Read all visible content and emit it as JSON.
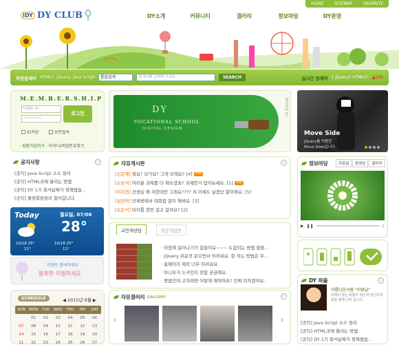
{
  "util": [
    "HOME",
    "SITEMAP",
    "FAVORITE"
  ],
  "logo": {
    "badge": "IDY",
    "name": "DY CLUB"
  },
  "gnb": [
    "DY소개",
    "커뮤니티",
    "갤러리",
    "정보마당",
    "DY운영"
  ],
  "search": {
    "label": "추천검색어",
    "hint": "HTML5, jQuery, Java Script",
    "select": "통합검색",
    "placeholder": "검색어를 입력해 주세요",
    "button": "SEARCH",
    "realtime_label": "실시간 검색어",
    "realtime_word": "1 jQuery? HTML5?",
    "realtime_count": "▲230"
  },
  "member": {
    "title": "M.E.M.B.E.R.S.H.I.P",
    "user_ph": "USER ID",
    "pass_ph": "••••••••",
    "login": "로그인",
    "save_id": "ID저장",
    "secure": "보안접속",
    "join": "· 회원가입하기",
    "find": "· 아이디/비밀번호찾기"
  },
  "notice_left": {
    "title": "공지사항",
    "items": [
      "[공지] Java Script 소스 정리",
      "[공지] HTML과제 올리는 방법",
      "[공지] DY 1기 회식날짜가 정해졌습...",
      "[공지] 물랑회원정리 들어갑니다."
    ]
  },
  "weather": {
    "word": "Today",
    "date": "월요일, 07/06",
    "temp": "28°",
    "f1_date": "10/18 25°",
    "f1_low": "11°",
    "f2_date": "10/18 25°",
    "f2_low": "11°"
  },
  "event": {
    "line1": "이벤트 참여하세요",
    "line2": "불혹한 리필하세요"
  },
  "schedule": {
    "title": "SCHEDULE",
    "month": "2015년 6월",
    "days": [
      "SUN",
      "MON",
      "TUE",
      "WED",
      "THU",
      "FRI",
      "SAT"
    ],
    "rows": [
      [
        "",
        "01",
        "02",
        "03",
        "04",
        "05",
        "06"
      ],
      [
        "07",
        "08",
        "09",
        "10",
        "11",
        "12",
        "13"
      ],
      [
        "14",
        "15",
        "16",
        "17",
        "18",
        "19",
        "20"
      ],
      [
        "21",
        "22",
        "23",
        "24",
        "25",
        "26",
        "27"
      ]
    ]
  },
  "banner": {
    "big": "DY",
    "line1": "VOCATIONAL SCHOOL",
    "line2": "DIGITAL DESIGN",
    "side": "NOTICE 01"
  },
  "board": {
    "title": "자유게시판",
    "items": [
      {
        "cat": "[신문혜]",
        "text": "뭐요? 모가요? 그게 모에요? [4]",
        "new": true
      },
      {
        "cat": "[오은석]",
        "text": "여러분 과제를 다 해오셨죠? 과제한거 업어보세요. [1]",
        "new": true
      },
      {
        "cat": "[이지연]",
        "text": "선생님 왜 저한테만 그래요???? 저 어제도 날겠단 말이에요. [5]",
        "new": false
      },
      {
        "cat": "[심진아]",
        "text": "단록방에서 대화좀 많이 해봐요. [3]",
        "new": false
      },
      {
        "cat": "[오은석]",
        "text": "타이틀 한번 걸고 갈까요? [2]",
        "new": false
      }
    ]
  },
  "tabs": {
    "active": "고민게상담",
    "inactive": "질문게답변",
    "items": [
      "· 아침에 일어나기가 힘들어요~~~ 도움되는 방법 없을...",
      "· jQuery 쉬운것 같으면서 어려워요. 잘 하는 방법은 무...",
      "· 홈페이지 제작 너무 어려워요.",
      "· 마니모가 누구인지 정말 궁금해요.",
      "· 평발인데 고치려면 어떻게 해야하죠? 진짜 미치겠어요."
    ]
  },
  "gallery": {
    "title": "자유갤러리",
    "sub": "GALLERY"
  },
  "moveside": {
    "title": "Move Side",
    "sub1": "jQuery를 적용한",
    "sub2": "Move Slide입니다"
  },
  "info": {
    "title": "정보마당",
    "tabs": [
      "자료실",
      "동영상",
      "갤러리"
    ]
  },
  "dy": {
    "title": "DY 파출",
    "name": "아름다운사람 \"지영님\"",
    "desc": "미래지 않는 바쁨이 당신과 당신이의 꿈을 향해 나아 갑니다.",
    "items": [
      "[공지] Java Script 소스 정리",
      "[공지] HTML과제 올리는 방법",
      "[공지] DY 1기 회식날짜가 정해졌습..."
    ]
  },
  "colors": {
    "accent": "#8fbf3a",
    "dark": "#5c8a1f"
  }
}
